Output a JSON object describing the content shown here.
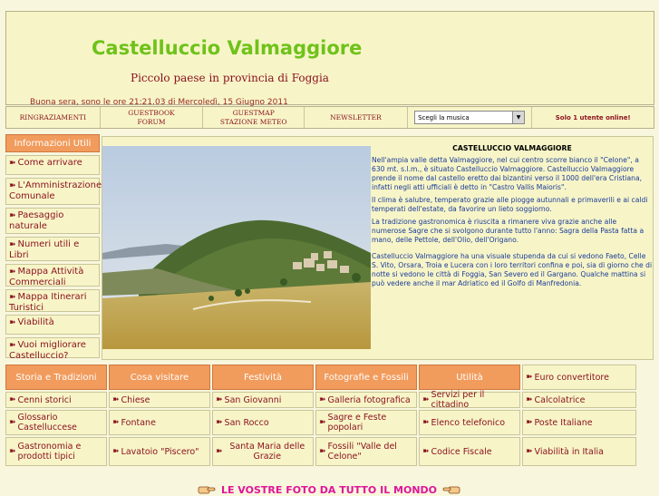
{
  "header": {
    "title": "Castelluccio Valmaggiore",
    "subtitle": "Piccolo paese in provincia di Foggia",
    "greeting": "Buona sera, sono le ore 21:21.03 di Mercoledì, 15 Giugno 2011"
  },
  "navbar": {
    "ringraziamenti": "RINGRAZIAMENTI",
    "guestbook": "GUESTBOOK",
    "forum": "FORUM",
    "guestmap": "GUESTMAP",
    "meteo": "STAZIONE METEO",
    "newsletter": "NEWSLETTER",
    "music_select": "Scegli la musica",
    "online": "Solo 1 utente online!"
  },
  "sidebar": {
    "header": "Informazioni Utili",
    "items": [
      {
        "label": "Come arrivare"
      },
      {
        "label": "L'Amministrazione Comunale"
      },
      {
        "label": "Paesaggio naturale"
      },
      {
        "label": "Numeri utili e Libri"
      },
      {
        "label": "Mappa Attività Commerciali"
      },
      {
        "label": "Mappa Itinerari Turistici"
      },
      {
        "label": "Viabilità"
      },
      {
        "label": "Vuoi migliorare Castelluccio?"
      }
    ]
  },
  "article": {
    "title": "CASTELLUCCIO VALMAGGIORE",
    "p1": "Nell'ampia valle detta Valmaggiore, nel cui centro scorre bianco il \"Celone\", a 630 mt. s.l.m., è situato Castelluccio Valmaggiore. Castelluccio Valmaggiore prende il nome dal castello eretto dai bizantini verso il 1000 dell'era Cristiana, infatti negli atti ufficiali è detto in \"Castro Vallis Maioris\".",
    "p2": "Il clima è salubre, temperato grazie alle piogge autunnali e primaverili e ai caldi temperati dell'estate, da favorire un lieto soggiorno.",
    "p3": "La tradizione gastronomica è riuscita a rimanere viva grazie anche alle numerose Sagre che si svolgono durante tutto l'anno: Sagra della Pasta fatta a mano, delle Pettole, dell'Olio, dell'Origano.",
    "p4": "Castelluccio Valmaggiore ha una visuale stupenda da cui si vedono Faeto, Celle S. Vito, Orsara, Troia e Lucera con i loro territori confina e poi, sia di giorno che di notte si vedono le città di Foggia, San Severo ed il Gargano. Qualche mattina si può vedere anche il mar Adriatico ed il Golfo di Manfredonia."
  },
  "bottom": {
    "columns": [
      {
        "header": "Storia e Tradizioni",
        "items": [
          "Cenni storici",
          "Glossario Castelluccese",
          "Gastronomia e prodotti tipici"
        ]
      },
      {
        "header": "Cosa visitare",
        "items": [
          "Chiese",
          "Fontane",
          "Lavatoio \"Piscero\""
        ]
      },
      {
        "header": "Festività",
        "items": [
          "San Giovanni",
          "San Rocco",
          "Santa Maria delle Grazie"
        ]
      },
      {
        "header": "Fotografie e Fossili",
        "items": [
          "Galleria fotografica",
          "Sagre e Feste popolari",
          "Fossili \"Valle del Celone\""
        ]
      },
      {
        "header": "Utilità",
        "items": [
          "Servizi per il cittadino",
          "Elenco telefonico",
          "Codice Fiscale"
        ]
      },
      {
        "header": "",
        "items": [
          "Euro convertitore",
          "Calcolatrice",
          "Poste Italiane",
          "Viabilità in Italia"
        ]
      }
    ]
  },
  "footer": {
    "banner": "LE VOSTRE FOTO DA TUTTO IL MONDO"
  },
  "colors": {
    "title_green": "#6fc21a",
    "accent_orange": "#f19b5c",
    "text_red": "#8a0f1e",
    "article_blue": "#1a3a9a",
    "panel_bg": "#f7f5c7",
    "banner_pink": "#e0159a"
  }
}
